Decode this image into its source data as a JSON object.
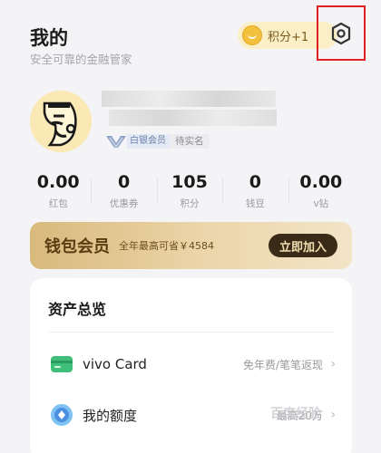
{
  "header": {
    "title": "我的",
    "subtitle": "安全可靠的金融管家",
    "points_badge": "积分+1",
    "settings_icon": "settings-hexagon-icon"
  },
  "profile": {
    "vip_label": "白银会员",
    "unverified_label": "待实名"
  },
  "stats": [
    {
      "value": "0.00",
      "label": "红包"
    },
    {
      "value": "0",
      "label": "优惠券"
    },
    {
      "value": "105",
      "label": "积分"
    },
    {
      "value": "0",
      "label": "钱豆"
    },
    {
      "value": "0.00",
      "label": "v钻"
    }
  ],
  "wallet_banner": {
    "title": "钱包会员",
    "description": "全年最高可省￥4584",
    "button": "立即加入"
  },
  "assets": {
    "title": "资产总览",
    "rows": [
      {
        "label": "vivo Card",
        "value": "免年费/笔笔返现",
        "icon": "card-icon"
      },
      {
        "label": "我的额度",
        "value": "最高20万",
        "icon": "credit-limit-icon"
      }
    ]
  },
  "watermark": "百度经验",
  "colors": {
    "highlight_box": "#e02020",
    "banner_gold": "#d9b97c",
    "button_dark": "#3a2b18"
  }
}
